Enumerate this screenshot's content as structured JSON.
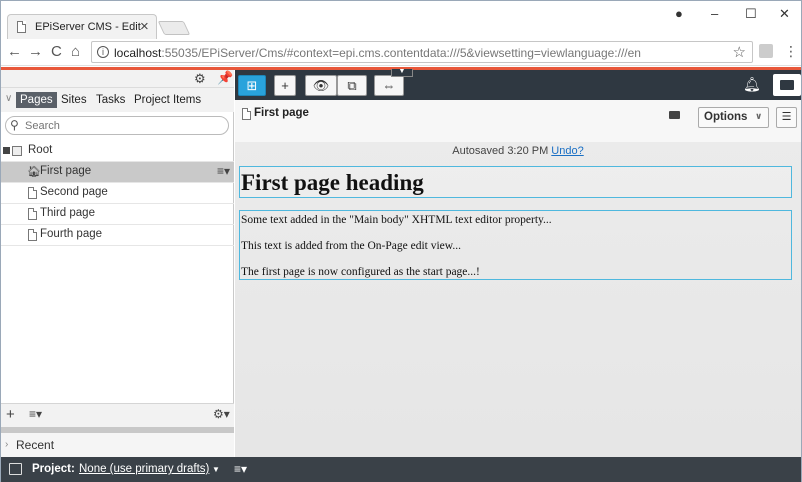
{
  "browser": {
    "tab_title": "EPiServer CMS - Edit",
    "tab_close": "×",
    "window_controls": {
      "minimize": "–",
      "maximize": "☐",
      "close": "✕",
      "profile": "●"
    },
    "url_host": "localhost",
    "url_rest": ":55035/EPiServer/Cms/#context=epi.cms.contentdata:///5&viewsetting=viewlanguage:///en",
    "nav": {
      "back": "←",
      "forward": "→",
      "reload": "C",
      "home": "⌂"
    },
    "star": "☆",
    "menu": "⋮"
  },
  "left_pane": {
    "tabs": [
      {
        "label": "Pages",
        "active": true
      },
      {
        "label": "Sites",
        "active": false
      },
      {
        "label": "Tasks",
        "active": false
      },
      {
        "label": "Project Items",
        "active": false
      }
    ],
    "search_placeholder": "Search",
    "tree": {
      "root": "Root",
      "items": [
        {
          "label": "First page",
          "selected": true,
          "icon": "home-icon"
        },
        {
          "label": "Second page",
          "selected": false,
          "icon": "page-icon"
        },
        {
          "label": "Third page",
          "selected": false,
          "icon": "page-icon"
        },
        {
          "label": "Fourth page",
          "selected": false,
          "icon": "page-icon"
        }
      ]
    },
    "recent_label": "Recent"
  },
  "editor": {
    "page_title": "First page",
    "options_label": "Options",
    "autosave_text": "Autosaved 3:20 PM",
    "undo_label": "Undo?",
    "heading": "First page heading",
    "body": [
      "Some text added in the \"Main body\" XHTML text editor property...",
      "This text is added from the On-Page edit view...",
      "The first page is now configured as the start page...!"
    ]
  },
  "footer": {
    "project_label": "Project:",
    "project_value": "None (use primary drafts)"
  },
  "colors": {
    "accent": "#29a3dc",
    "orange_bar": "#e8583b",
    "global_toolbar": "#2f3841",
    "footer": "#3a4148",
    "block_outline": "#4fb8de"
  }
}
